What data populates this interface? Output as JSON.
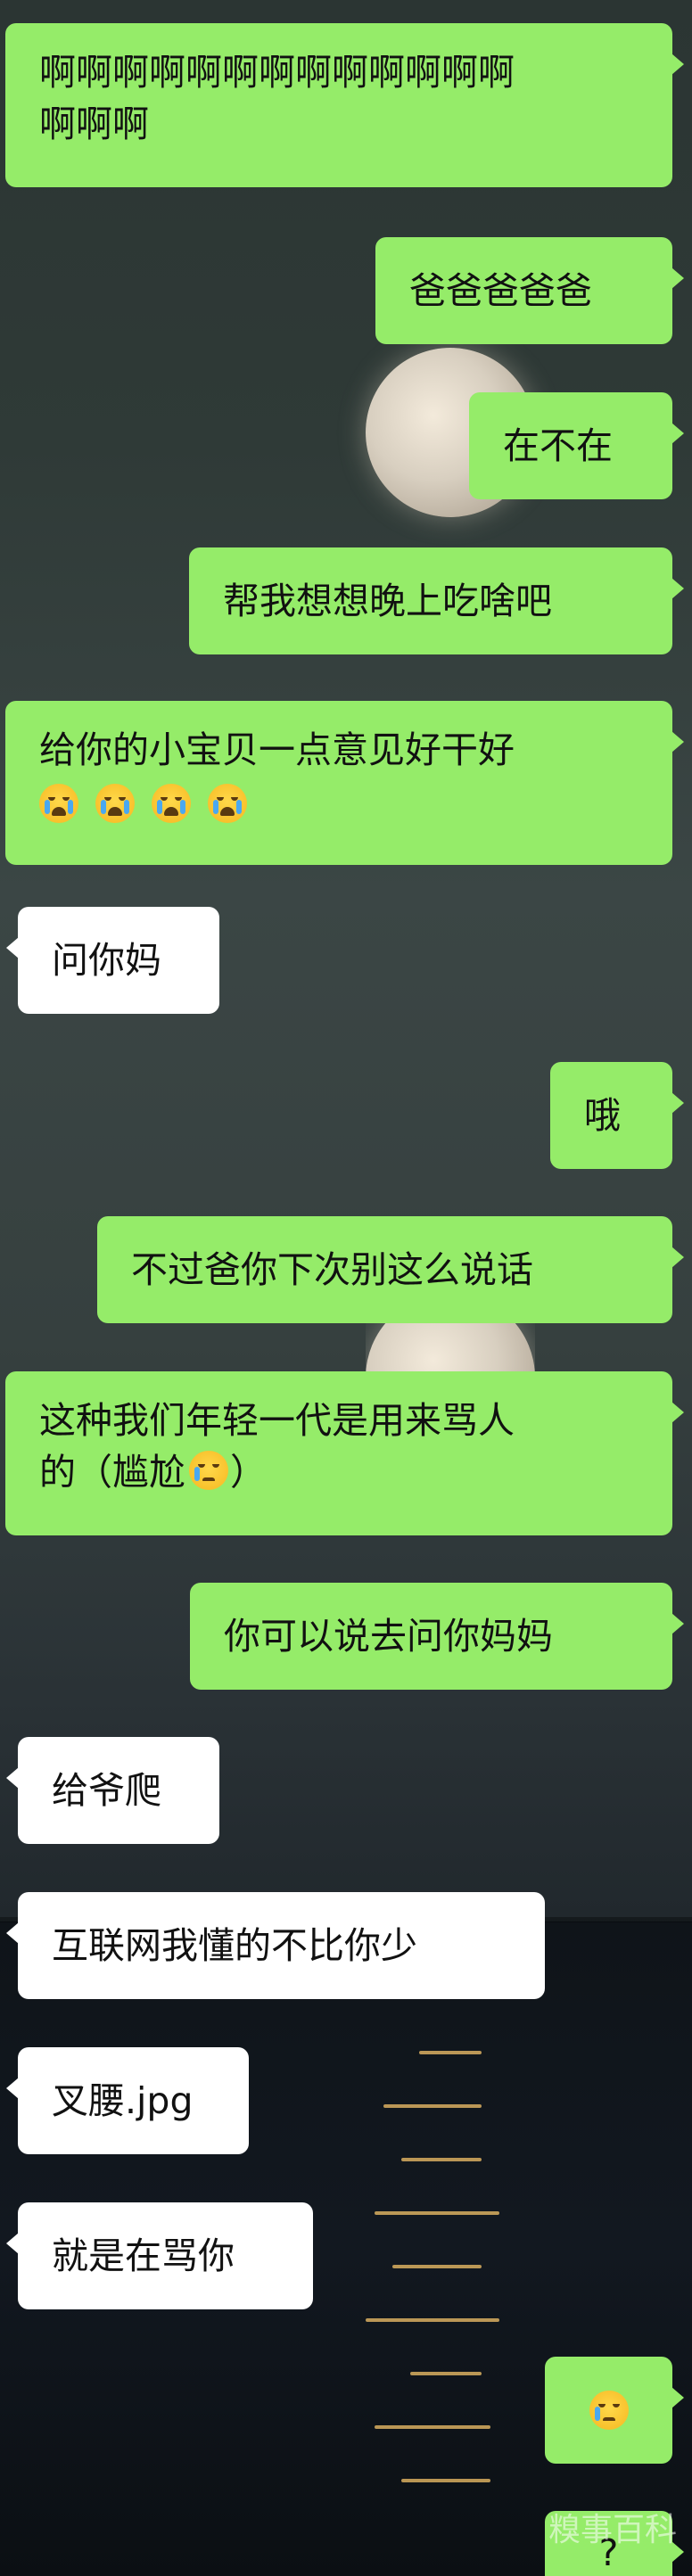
{
  "chat": {
    "messages": [
      {
        "side": "out",
        "text": "啊啊啊啊啊啊啊啊啊啊啊啊啊\n啊啊啊"
      },
      {
        "side": "out",
        "text": "爸爸爸爸爸"
      },
      {
        "side": "out",
        "text": "在不在"
      },
      {
        "side": "out",
        "text": "帮我想想晚上吃啥吧"
      },
      {
        "side": "out",
        "text": "给你的小宝贝一点意见好干好",
        "emojis": [
          "loudly-crying-face",
          "loudly-crying-face",
          "loudly-crying-face",
          "loudly-crying-face"
        ]
      },
      {
        "side": "in",
        "text": "问你妈"
      },
      {
        "side": "out",
        "text": "哦"
      },
      {
        "side": "out",
        "text": "不过爸你下次别这么说话"
      },
      {
        "side": "out",
        "text_line1": "这种我们年轻一代是用来骂人",
        "text_line2_prefix": "的（尴尬",
        "emoji": "crying-face",
        "text_line2_suffix": "）"
      },
      {
        "side": "out",
        "text": "你可以说去问你妈妈"
      },
      {
        "side": "in",
        "text": "给爷爬"
      },
      {
        "side": "in",
        "text": "互联网我懂的不比你少"
      },
      {
        "side": "in",
        "text": "叉腰.jpg"
      },
      {
        "side": "in",
        "text": "就是在骂你"
      },
      {
        "side": "out",
        "emoji": "crying-face"
      },
      {
        "side": "out",
        "text": "?"
      }
    ]
  },
  "watermark": "糗事百科",
  "colors": {
    "outgoing_bubble": "#95ec69",
    "incoming_bubble": "#ffffff",
    "text": "#111111"
  }
}
